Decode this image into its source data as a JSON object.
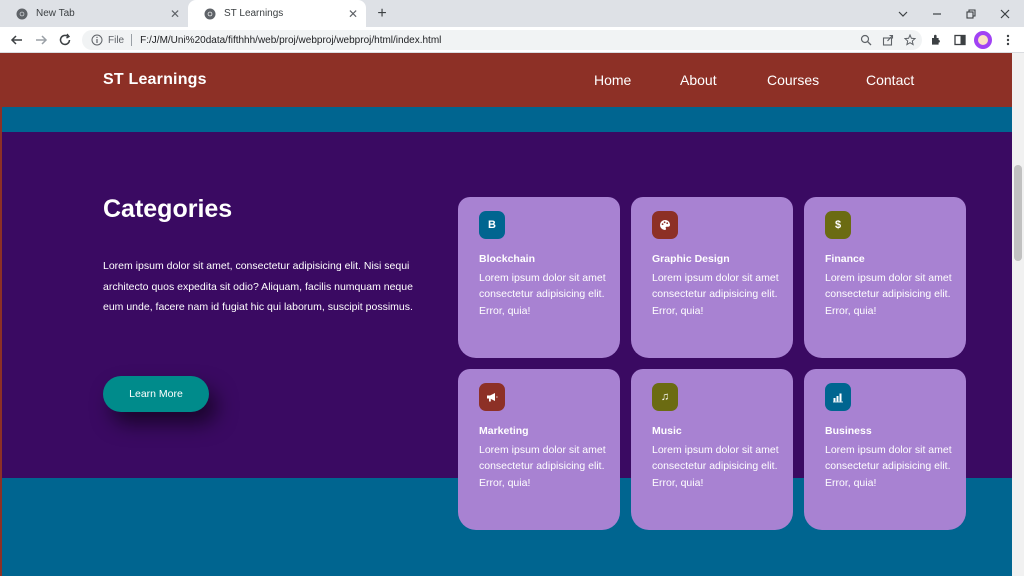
{
  "browser": {
    "tabs": [
      {
        "title": "New Tab",
        "active": false
      },
      {
        "title": "ST Learnings",
        "active": true
      }
    ],
    "new_tab_label": "+",
    "address": {
      "scheme_label": "File",
      "url": "F:/J/M/Uni%20data/fifthhh/web/proj/webproj/webproj/html/index.html"
    }
  },
  "page": {
    "brand": "ST Learnings",
    "nav": [
      "Home",
      "About",
      "Courses",
      "Contact"
    ],
    "categories": {
      "title": "Categories",
      "description": "Lorem ipsum dolor sit amet, consectetur adipisicing elit. Nisi sequi architecto quos expedita sit odio? Aliquam, facilis numquam neque eum unde, facere nam id fugiat hic qui laborum, suscipit possimus.",
      "button_label": "Learn More"
    },
    "cards": [
      {
        "title": "Blockchain",
        "icon": "bitcoin-icon",
        "glyph": "B",
        "color": "#006590",
        "text": "Lorem ipsum dolor sit amet consectetur adipisicing elit. Error, quia!"
      },
      {
        "title": "Graphic Design",
        "icon": "palette-icon",
        "glyph": "",
        "color": "#8d3026",
        "text": "Lorem ipsum dolor sit amet consectetur adipisicing elit. Error, quia!"
      },
      {
        "title": "Finance",
        "icon": "dollar-icon",
        "glyph": "$",
        "color": "#6b6b12",
        "text": "Lorem ipsum dolor sit amet consectetur adipisicing elit. Error, quia!"
      },
      {
        "title": "Marketing",
        "icon": "megaphone-icon",
        "glyph": "",
        "color": "#8d3026",
        "text": "Lorem ipsum dolor sit amet consectetur adipisicing elit. Error, quia!"
      },
      {
        "title": "Music",
        "icon": "music-note-icon",
        "glyph": "♫",
        "color": "#6b6b12",
        "text": "Lorem ipsum dolor sit amet consectetur adipisicing elit. Error, quia!"
      },
      {
        "title": "Business",
        "icon": "chart-icon",
        "glyph": "",
        "color": "#006590",
        "text": "Lorem ipsum dolor sit amet consectetur adipisicing elit. Error, quia!"
      }
    ]
  },
  "colors": {
    "navbar": "#8d3026",
    "purple_section": "#3a0a62",
    "teal_band": "#006590",
    "card_bg": "#a882d2",
    "button_bg": "#008b8b"
  }
}
